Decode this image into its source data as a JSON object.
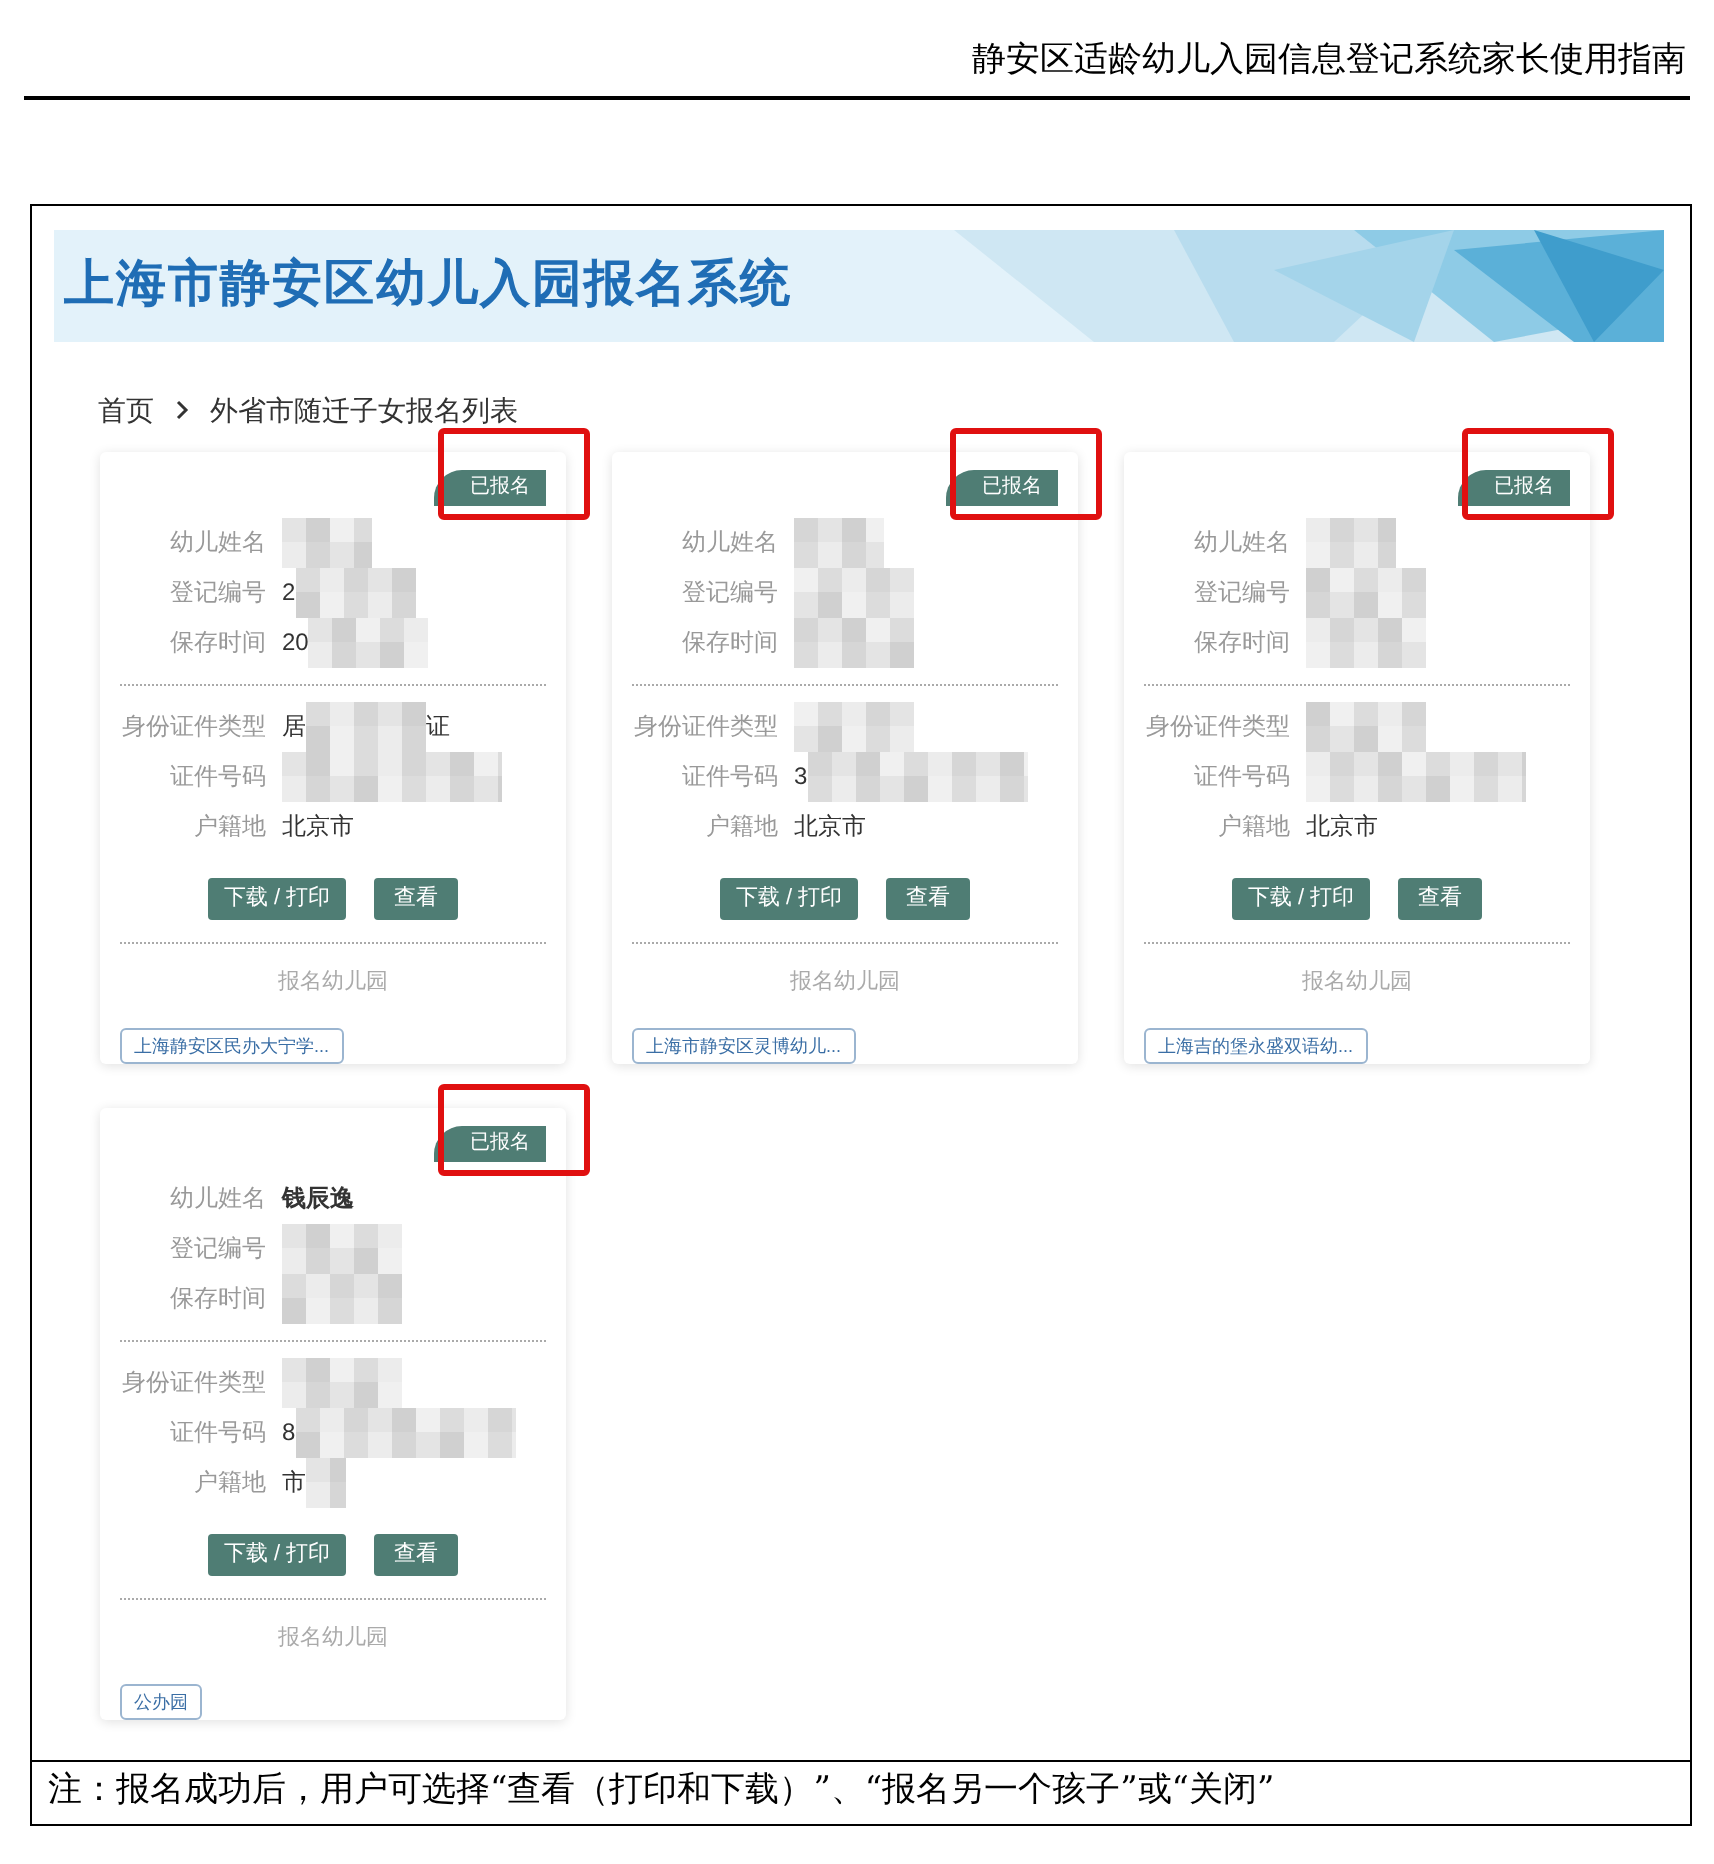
{
  "document_header": {
    "title": "静安区适龄幼儿入园信息登记系统家长使用指南"
  },
  "app": {
    "title": "上海市静安区幼儿入园报名系统",
    "breadcrumb": [
      {
        "label": "首页"
      },
      {
        "label": "外省市随迁子女报名列表"
      }
    ],
    "cards": [
      {
        "status": "已报名",
        "highlighted": true,
        "fields": [
          {
            "label": "幼儿姓名",
            "blurred": true
          },
          {
            "label": "登记编号",
            "value": "2",
            "blurred": true
          },
          {
            "label": "保存时间",
            "value": "20",
            "blurred": true
          },
          {
            "label": "身份证件类型",
            "value": "居",
            "blurred": true,
            "value_after": "证"
          },
          {
            "label": "证件号码",
            "blurred": true
          },
          {
            "label": "户籍地",
            "value": "北京市",
            "blurred": false
          }
        ],
        "buttons": [
          "下载 / 打印",
          "查看"
        ],
        "kindergarten_heading": "报名幼儿园",
        "kindergarten": "上海静安区民办大宁学..."
      },
      {
        "status": "已报名",
        "highlighted": true,
        "fields": [
          {
            "label": "幼儿姓名",
            "blurred": true
          },
          {
            "label": "登记编号",
            "blurred": true
          },
          {
            "label": "保存时间",
            "blurred": true
          },
          {
            "label": "身份证件类型",
            "blurred": true
          },
          {
            "label": "证件号码",
            "value": "3",
            "blurred": true
          },
          {
            "label": "户籍地",
            "value": "北京市",
            "blurred": false
          }
        ],
        "buttons": [
          "下载 / 打印",
          "查看"
        ],
        "kindergarten_heading": "报名幼儿园",
        "kindergarten": "上海市静安区灵博幼儿..."
      },
      {
        "status": "已报名",
        "highlighted": true,
        "fields": [
          {
            "label": "幼儿姓名",
            "blurred": true
          },
          {
            "label": "登记编号",
            "blurred": true
          },
          {
            "label": "保存时间",
            "blurred": true
          },
          {
            "label": "身份证件类型",
            "blurred": true
          },
          {
            "label": "证件号码",
            "blurred": true
          },
          {
            "label": "户籍地",
            "value": "北京市",
            "blurred": false
          }
        ],
        "buttons": [
          "下载 / 打印",
          "查看"
        ],
        "kindergarten_heading": "报名幼儿园",
        "kindergarten": "上海吉的堡永盛双语幼..."
      },
      {
        "status": "已报名",
        "highlighted": true,
        "fields": [
          {
            "label": "幼儿姓名",
            "value": "钱辰逸",
            "blurred": false
          },
          {
            "label": "登记编号",
            "blurred": true
          },
          {
            "label": "保存时间",
            "blurred": true
          },
          {
            "label": "身份证件类型",
            "blurred": true
          },
          {
            "label": "证件号码",
            "value": "8",
            "blurred": true
          },
          {
            "label": "户籍地",
            "value": "市",
            "blurred": true
          }
        ],
        "buttons": [
          "下载 / 打印",
          "查看"
        ],
        "kindergarten_heading": "报名幼儿园",
        "kindergarten": "公办园"
      }
    ]
  },
  "note": "注：报名成功后，用户可选择“查看（打印和下载）”、“报名另一个孩子”或“关闭”"
}
